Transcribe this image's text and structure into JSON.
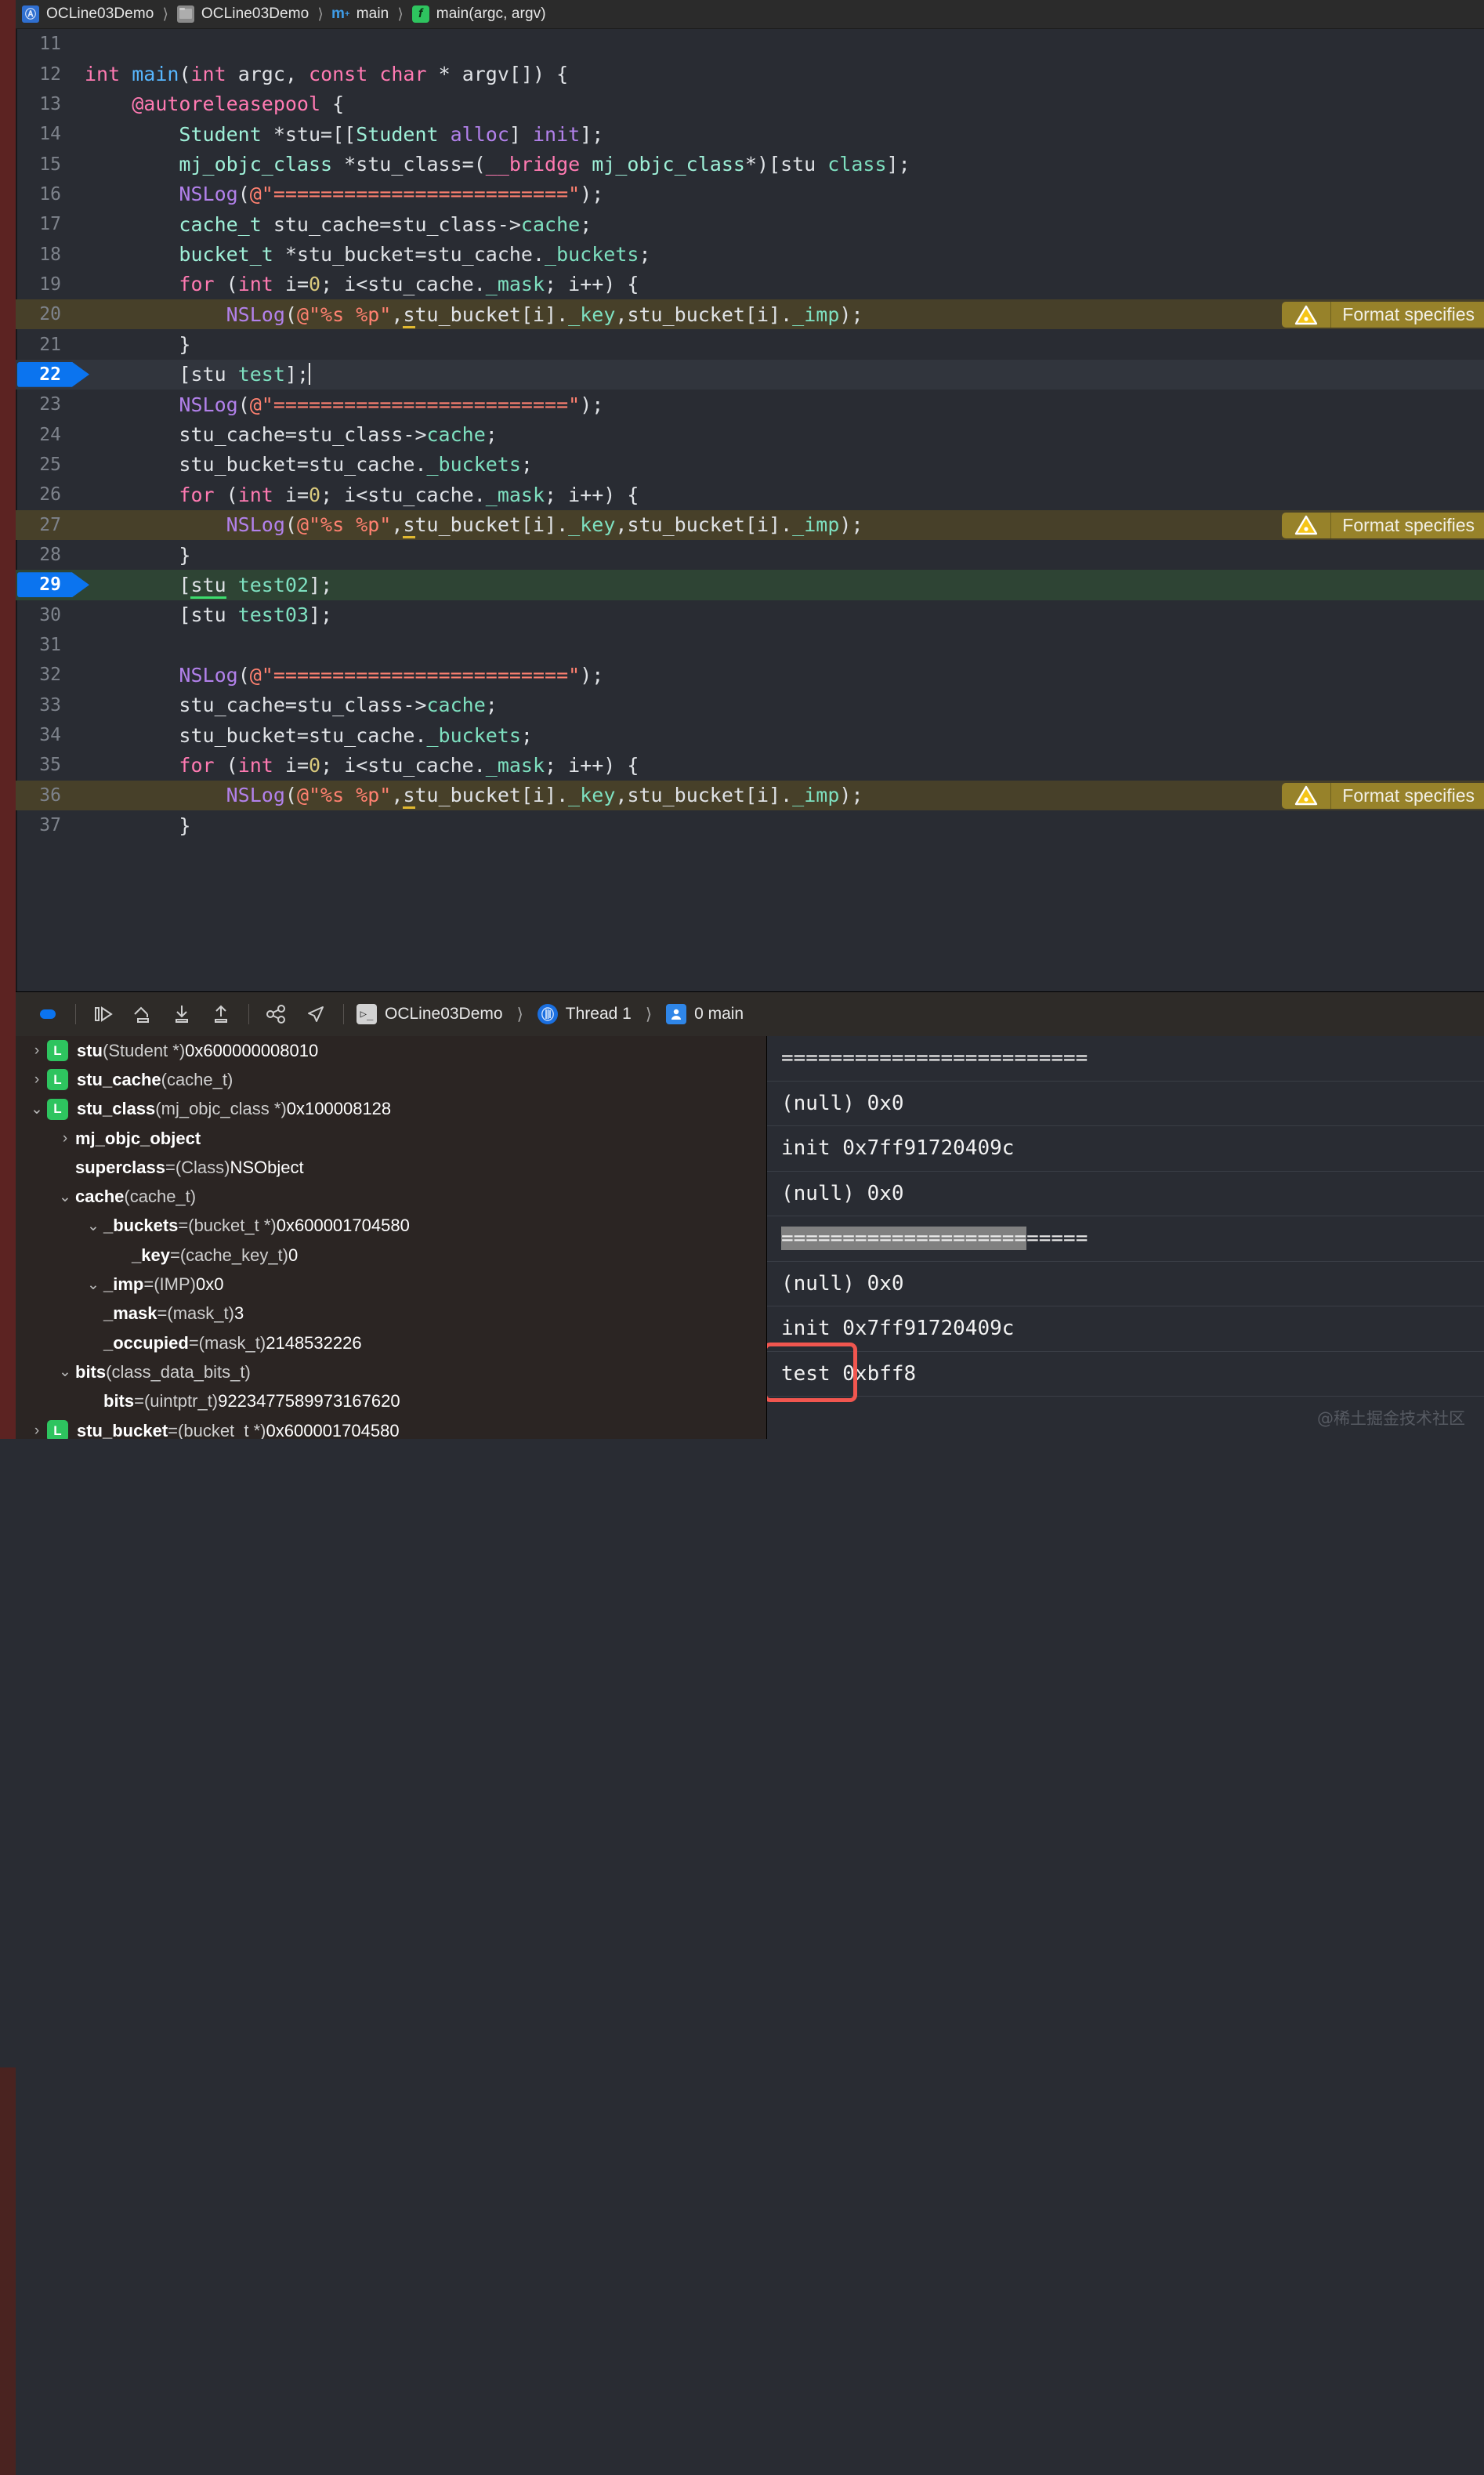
{
  "window": {
    "accent_blue": "#0b74ef",
    "warning_yellow": "#97822a",
    "current_line_green": "#2e4434",
    "annotation_red": "#f1564f"
  },
  "breadcrumb": {
    "items": [
      {
        "icon": "project-icon",
        "glyph": "Ⓐ",
        "label": "OCLine03Demo"
      },
      {
        "icon": "folder-icon",
        "glyph": "",
        "label": "OCLine03Demo"
      },
      {
        "icon": "objc-file-icon",
        "glyph": "m",
        "label": "main"
      },
      {
        "icon": "function-icon",
        "glyph": "f",
        "label": "main(argc, argv)"
      }
    ],
    "separator": "⟩"
  },
  "editor": {
    "warning_badge_label": "Format specifies",
    "warning_icon": "warning-triangle-icon",
    "lines": [
      {
        "n": "11",
        "tokens": [],
        "state": "normal"
      },
      {
        "n": "12",
        "state": "normal",
        "tokens": [
          {
            "t": "int ",
            "c": "k"
          },
          {
            "t": "main",
            "c": "fn"
          },
          {
            "t": "(",
            "c": "pl"
          },
          {
            "t": "int",
            "c": "k"
          },
          {
            "t": " argc, ",
            "c": "pl"
          },
          {
            "t": "const ",
            "c": "k"
          },
          {
            "t": "char",
            "c": "k"
          },
          {
            "t": " * argv[]) {",
            "c": "pl"
          }
        ]
      },
      {
        "n": "13",
        "state": "normal",
        "indent": 1,
        "tokens": [
          {
            "t": "@autoreleasepool",
            "c": "k"
          },
          {
            "t": " {",
            "c": "pl"
          }
        ]
      },
      {
        "n": "14",
        "state": "normal",
        "indent": 2,
        "tokens": [
          {
            "t": "Student",
            "c": "ty"
          },
          {
            "t": " *stu=[[",
            "c": "pl"
          },
          {
            "t": "Student",
            "c": "ty"
          },
          {
            "t": " ",
            "c": "pl"
          },
          {
            "t": "alloc",
            "c": "cl"
          },
          {
            "t": "] ",
            "c": "pl"
          },
          {
            "t": "init",
            "c": "cl"
          },
          {
            "t": "];",
            "c": "pl"
          }
        ]
      },
      {
        "n": "15",
        "state": "normal",
        "indent": 2,
        "tokens": [
          {
            "t": "mj_objc_class",
            "c": "ty"
          },
          {
            "t": " *stu_class=(",
            "c": "pl"
          },
          {
            "t": "__bridge",
            "c": "k"
          },
          {
            "t": " ",
            "c": "pl"
          },
          {
            "t": "mj_objc_class",
            "c": "ty"
          },
          {
            "t": "*)[stu ",
            "c": "pl"
          },
          {
            "t": "class",
            "c": "msg"
          },
          {
            "t": "];",
            "c": "pl"
          }
        ]
      },
      {
        "n": "16",
        "state": "normal",
        "indent": 2,
        "tokens": [
          {
            "t": "NSLog",
            "c": "cl"
          },
          {
            "t": "(",
            "c": "pl"
          },
          {
            "t": "@\"=========================\"",
            "c": "str"
          },
          {
            "t": ");",
            "c": "pl"
          }
        ]
      },
      {
        "n": "17",
        "state": "normal",
        "indent": 2,
        "tokens": [
          {
            "t": "cache_t",
            "c": "ty"
          },
          {
            "t": " stu_cache=stu_class->",
            "c": "pl"
          },
          {
            "t": "cache",
            "c": "mem"
          },
          {
            "t": ";",
            "c": "pl"
          }
        ]
      },
      {
        "n": "18",
        "state": "normal",
        "indent": 2,
        "tokens": [
          {
            "t": "bucket_t",
            "c": "ty"
          },
          {
            "t": " *stu_bucket=stu_cache.",
            "c": "pl"
          },
          {
            "t": "_buckets",
            "c": "mem"
          },
          {
            "t": ";",
            "c": "pl"
          }
        ]
      },
      {
        "n": "19",
        "state": "normal",
        "indent": 2,
        "tokens": [
          {
            "t": "for",
            "c": "k"
          },
          {
            "t": " (",
            "c": "pl"
          },
          {
            "t": "int",
            "c": "k"
          },
          {
            "t": " i=",
            "c": "pl"
          },
          {
            "t": "0",
            "c": "num"
          },
          {
            "t": "; i<stu_cache.",
            "c": "pl"
          },
          {
            "t": "_mask",
            "c": "mem"
          },
          {
            "t": "; i++) {",
            "c": "pl"
          }
        ]
      },
      {
        "n": "20",
        "state": "warn",
        "indent": 3,
        "tokens": [
          {
            "t": "NSLog",
            "c": "cl"
          },
          {
            "t": "(",
            "c": "pl"
          },
          {
            "t": "@\"%s %p\"",
            "c": "str"
          },
          {
            "t": ",",
            "c": "pl"
          },
          {
            "t": "s",
            "c": "pl",
            "u": "y"
          },
          {
            "t": "tu_bucket[i].",
            "c": "pl"
          },
          {
            "t": "_key",
            "c": "mem"
          },
          {
            "t": ",stu_bucket[i].",
            "c": "pl"
          },
          {
            "t": "_imp",
            "c": "mem"
          },
          {
            "t": ");",
            "c": "pl"
          }
        ]
      },
      {
        "n": "21",
        "state": "normal",
        "indent": 2,
        "tokens": [
          {
            "t": "}",
            "c": "pl"
          }
        ]
      },
      {
        "n": "22",
        "state": "cursorline",
        "bp": true,
        "indent": 2,
        "tokens": [
          {
            "t": "[stu ",
            "c": "pl"
          },
          {
            "t": "test",
            "c": "msg"
          },
          {
            "t": "];",
            "c": "pl"
          },
          {
            "t": "",
            "c": "caret"
          }
        ]
      },
      {
        "n": "23",
        "state": "normal",
        "indent": 2,
        "tokens": [
          {
            "t": "NSLog",
            "c": "cl"
          },
          {
            "t": "(",
            "c": "pl"
          },
          {
            "t": "@\"=========================\"",
            "c": "str"
          },
          {
            "t": ");",
            "c": "pl"
          }
        ]
      },
      {
        "n": "24",
        "state": "normal",
        "indent": 2,
        "tokens": [
          {
            "t": "stu_cache=stu_class->",
            "c": "pl"
          },
          {
            "t": "cache",
            "c": "mem"
          },
          {
            "t": ";",
            "c": "pl"
          }
        ]
      },
      {
        "n": "25",
        "state": "normal",
        "indent": 2,
        "tokens": [
          {
            "t": "stu_bucket=stu_cache.",
            "c": "pl"
          },
          {
            "t": "_buckets",
            "c": "mem"
          },
          {
            "t": ";",
            "c": "pl"
          }
        ]
      },
      {
        "n": "26",
        "state": "normal",
        "indent": 2,
        "tokens": [
          {
            "t": "for",
            "c": "k"
          },
          {
            "t": " (",
            "c": "pl"
          },
          {
            "t": "int",
            "c": "k"
          },
          {
            "t": " i=",
            "c": "pl"
          },
          {
            "t": "0",
            "c": "num"
          },
          {
            "t": "; i<stu_cache.",
            "c": "pl"
          },
          {
            "t": "_mask",
            "c": "mem"
          },
          {
            "t": "; i++) {",
            "c": "pl"
          }
        ]
      },
      {
        "n": "27",
        "state": "warn",
        "indent": 3,
        "tokens": [
          {
            "t": "NSLog",
            "c": "cl"
          },
          {
            "t": "(",
            "c": "pl"
          },
          {
            "t": "@\"%s %p\"",
            "c": "str"
          },
          {
            "t": ",",
            "c": "pl"
          },
          {
            "t": "s",
            "c": "pl",
            "u": "y"
          },
          {
            "t": "tu_bucket[i].",
            "c": "pl"
          },
          {
            "t": "_key",
            "c": "mem"
          },
          {
            "t": ",stu_bucket[i].",
            "c": "pl"
          },
          {
            "t": "_imp",
            "c": "mem"
          },
          {
            "t": ");",
            "c": "pl"
          }
        ]
      },
      {
        "n": "28",
        "state": "normal",
        "indent": 2,
        "tokens": [
          {
            "t": "}",
            "c": "pl"
          }
        ]
      },
      {
        "n": "29",
        "state": "current",
        "bp": true,
        "indent": 2,
        "tokens": [
          {
            "t": "[",
            "c": "pl"
          },
          {
            "t": "stu",
            "c": "pl",
            "u": "g"
          },
          {
            "t": " ",
            "c": "pl"
          },
          {
            "t": "test02",
            "c": "msg"
          },
          {
            "t": "];",
            "c": "pl"
          }
        ]
      },
      {
        "n": "30",
        "state": "normal",
        "indent": 2,
        "tokens": [
          {
            "t": "[stu ",
            "c": "pl"
          },
          {
            "t": "test03",
            "c": "msg"
          },
          {
            "t": "];",
            "c": "pl"
          }
        ]
      },
      {
        "n": "31",
        "state": "normal",
        "tokens": []
      },
      {
        "n": "32",
        "state": "normal",
        "indent": 2,
        "tokens": [
          {
            "t": "NSLog",
            "c": "cl"
          },
          {
            "t": "(",
            "c": "pl"
          },
          {
            "t": "@\"=========================\"",
            "c": "str"
          },
          {
            "t": ");",
            "c": "pl"
          }
        ]
      },
      {
        "n": "33",
        "state": "normal",
        "indent": 2,
        "tokens": [
          {
            "t": "stu_cache=stu_class->",
            "c": "pl"
          },
          {
            "t": "cache",
            "c": "mem"
          },
          {
            "t": ";",
            "c": "pl"
          }
        ]
      },
      {
        "n": "34",
        "state": "normal",
        "indent": 2,
        "tokens": [
          {
            "t": "stu_bucket=stu_cache.",
            "c": "pl"
          },
          {
            "t": "_buckets",
            "c": "mem"
          },
          {
            "t": ";",
            "c": "pl"
          }
        ]
      },
      {
        "n": "35",
        "state": "normal",
        "indent": 2,
        "tokens": [
          {
            "t": "for",
            "c": "k"
          },
          {
            "t": " (",
            "c": "pl"
          },
          {
            "t": "int",
            "c": "k"
          },
          {
            "t": " i=",
            "c": "pl"
          },
          {
            "t": "0",
            "c": "num"
          },
          {
            "t": "; i<stu_cache.",
            "c": "pl"
          },
          {
            "t": "_mask",
            "c": "mem"
          },
          {
            "t": "; i++) {",
            "c": "pl"
          }
        ]
      },
      {
        "n": "36",
        "state": "warn",
        "indent": 3,
        "tokens": [
          {
            "t": "NSLog",
            "c": "cl"
          },
          {
            "t": "(",
            "c": "pl"
          },
          {
            "t": "@\"%s %p\"",
            "c": "str"
          },
          {
            "t": ",",
            "c": "pl"
          },
          {
            "t": "s",
            "c": "pl",
            "u": "y"
          },
          {
            "t": "tu_bucket[i].",
            "c": "pl"
          },
          {
            "t": "_key",
            "c": "mem"
          },
          {
            "t": ",stu_bucket[i].",
            "c": "pl"
          },
          {
            "t": "_imp",
            "c": "mem"
          },
          {
            "t": ");",
            "c": "pl"
          }
        ]
      },
      {
        "n": "37",
        "state": "normal",
        "indent": 2,
        "tokens": [
          {
            "t": "}",
            "c": "pl"
          }
        ]
      }
    ]
  },
  "debug_bar": {
    "buttons": [
      {
        "name": "stop-button",
        "icon": "stop-icon"
      },
      {
        "name": "continue-button",
        "icon": "continue-program-icon"
      },
      {
        "name": "step-over-button",
        "icon": "step-over-icon"
      },
      {
        "name": "step-into-button",
        "icon": "step-into-icon"
      },
      {
        "name": "step-out-button",
        "icon": "step-out-icon"
      },
      {
        "name": "debug-view-hierarchy-button",
        "icon": "view-hierarchy-icon"
      },
      {
        "name": "simulate-location-button",
        "icon": "location-arrow-icon"
      }
    ],
    "process": "OCLine03Demo",
    "thread": "Thread 1",
    "frame": "0 main",
    "separator": "⟩"
  },
  "variables": [
    {
      "indent": 0,
      "tw": "›",
      "badge": "L",
      "name": "stu",
      "type": "(Student *)",
      "value": "0x600000008010"
    },
    {
      "indent": 0,
      "tw": "›",
      "badge": "L",
      "name": "stu_cache",
      "type": "(cache_t)",
      "value": ""
    },
    {
      "indent": 0,
      "tw": "⌄",
      "badge": "L",
      "name": "stu_class",
      "type": "(mj_objc_class *)",
      "value": "0x100008128"
    },
    {
      "indent": 1,
      "tw": "›",
      "badge": "",
      "name": "mj_objc_object",
      "type": "",
      "value": ""
    },
    {
      "indent": 1,
      "tw": "",
      "badge": "",
      "name": "superclass",
      "type": "(Class)",
      "value": "NSObject",
      "eq": true
    },
    {
      "indent": 1,
      "tw": "⌄",
      "badge": "",
      "name": "cache",
      "type": "(cache_t)",
      "value": ""
    },
    {
      "indent": 2,
      "tw": "⌄",
      "badge": "",
      "name": "_buckets",
      "type": "(bucket_t *)",
      "value": "0x600001704580",
      "eq": true
    },
    {
      "indent": 3,
      "tw": "",
      "badge": "",
      "name": "_key",
      "type": "(cache_key_t)",
      "value": "0",
      "eq": true
    },
    {
      "indent": 2,
      "tw": "⌄",
      "badge": "",
      "name": "_imp",
      "type": "(IMP)",
      "value": "0x0",
      "eq": true
    },
    {
      "indent": 2,
      "tw": "",
      "badge": "",
      "name": "_mask",
      "type": "(mask_t)",
      "value": "3",
      "eq": true
    },
    {
      "indent": 2,
      "tw": "",
      "badge": "",
      "name": "_occupied",
      "type": "(mask_t)",
      "value": "2148532226",
      "eq": true
    },
    {
      "indent": 1,
      "tw": "⌄",
      "badge": "",
      "name": "bits",
      "type": "(class_data_bits_t)",
      "value": ""
    },
    {
      "indent": 2,
      "tw": "",
      "badge": "",
      "name": "bits",
      "type": "(uintptr_t)",
      "value": "9223477589973167620",
      "eq": true
    },
    {
      "indent": 0,
      "tw": "›",
      "badge": "L",
      "name": "stu_bucket",
      "type": "(bucket_t *)",
      "value": "0x600001704580",
      "eq": true
    }
  ],
  "console": {
    "lines": [
      {
        "text": "=========================",
        "highlight": null
      },
      {
        "text": "(null) 0x0",
        "highlight": null
      },
      {
        "text": "init 0x7ff91720409c",
        "highlight": null
      },
      {
        "text": "(null) 0x0",
        "highlight": null
      },
      {
        "text": "=========================",
        "highlight": {
          "start": 0,
          "end": 20
        }
      },
      {
        "text": "(null) 0x0",
        "highlight": null
      },
      {
        "text": "init 0x7ff91720409c",
        "highlight": null
      },
      {
        "text": "test 0xbff8",
        "highlight": null,
        "annotated": true
      }
    ]
  },
  "watermark": "@稀土掘金技术社区"
}
